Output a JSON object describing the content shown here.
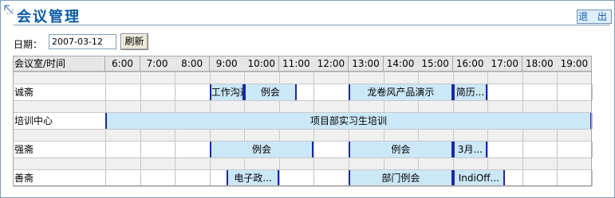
{
  "header": {
    "title": "会议管理",
    "exit_label": "退 出",
    "icon": "corner-arrow-icon"
  },
  "filter": {
    "date_label": "日期：",
    "date_value": "2007-03-12",
    "refresh_label": "刷新"
  },
  "table": {
    "room_header": "会议室/时间",
    "hours": [
      "6:00",
      "7:00",
      "8:00",
      "9:00",
      "10:00",
      "11:00",
      "12:00",
      "13:00",
      "14:00",
      "15:00",
      "16:00",
      "17:00",
      "18:00",
      "19:00"
    ],
    "rooms": [
      {
        "name": "诚斋",
        "bookings": [
          {
            "title": "工作沟通",
            "start": "9:00",
            "end": "10:00"
          },
          {
            "title": "例会",
            "start": "10:00",
            "end": "11:30"
          },
          {
            "title": "龙卷风产品演示",
            "start": "13:00",
            "end": "16:00"
          },
          {
            "title": "简历...",
            "start": "16:00",
            "end": "17:00"
          }
        ]
      },
      {
        "name": "培训中心",
        "bookings": [
          {
            "title": "项目部实习生培训",
            "start": "6:00",
            "end": "20:00"
          }
        ]
      },
      {
        "name": "强斋",
        "bookings": [
          {
            "title": "例会",
            "start": "9:00",
            "end": "12:00"
          },
          {
            "title": "例会",
            "start": "13:00",
            "end": "16:00"
          },
          {
            "title": "3月...",
            "start": "16:00",
            "end": "17:00"
          }
        ]
      },
      {
        "name": "善斋",
        "bookings": [
          {
            "title": "电子政...",
            "start": "9:30",
            "end": "11:00"
          },
          {
            "title": "部门例会",
            "start": "13:00",
            "end": "16:00"
          },
          {
            "title": "IndiOff...",
            "start": "16:00",
            "end": "17:30"
          }
        ]
      }
    ]
  }
}
